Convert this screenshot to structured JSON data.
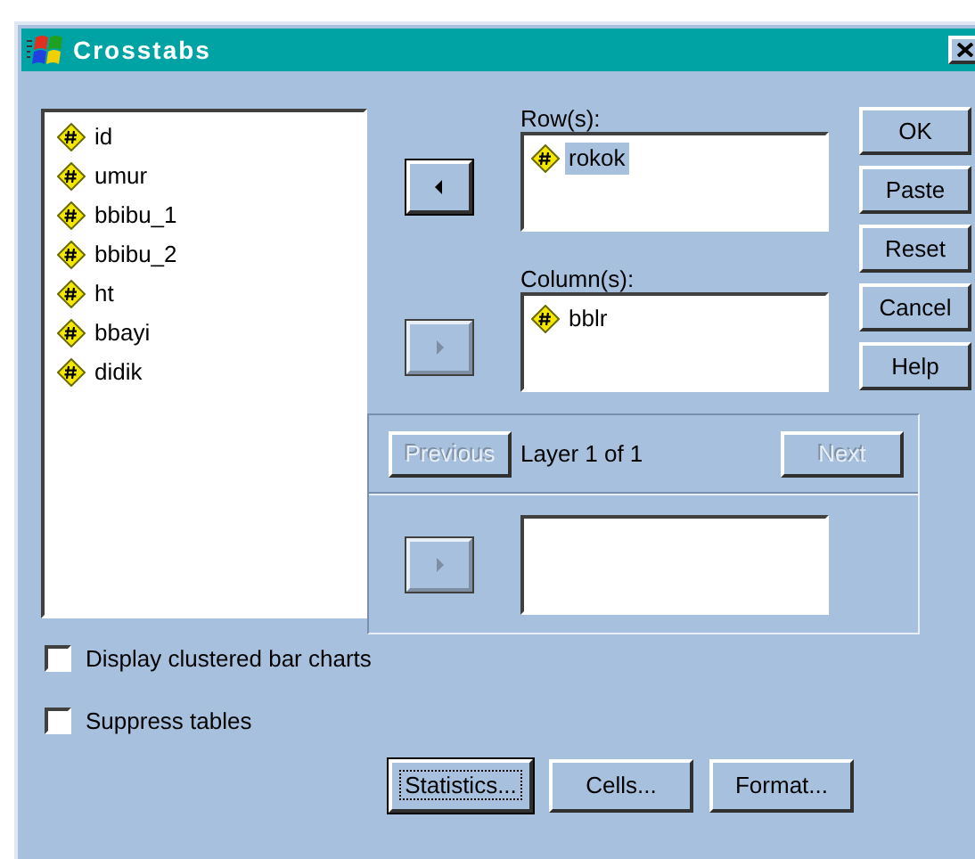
{
  "window": {
    "title": "Crosstabs"
  },
  "variables": [
    {
      "name": "id",
      "selected": false
    },
    {
      "name": "umur",
      "selected": false
    },
    {
      "name": "bbibu_1",
      "selected": false
    },
    {
      "name": "bbibu_2",
      "selected": false
    },
    {
      "name": "ht",
      "selected": false
    },
    {
      "name": "bbayi",
      "selected": false
    },
    {
      "name": "didik",
      "selected": false
    }
  ],
  "move_buttons": [
    {
      "kind": "left",
      "disabled": false
    },
    {
      "kind": "right",
      "disabled": true
    }
  ],
  "rows": {
    "label": "Row(s):",
    "items": [
      {
        "name": "rokok",
        "selected": true
      }
    ]
  },
  "columns": {
    "label": "Column(s):",
    "items": [
      {
        "name": "bblr",
        "selected": false
      }
    ]
  },
  "side_buttons": [
    {
      "label": "OK"
    },
    {
      "label": "Paste"
    },
    {
      "label": "Reset"
    },
    {
      "label": "Cancel"
    },
    {
      "label": "Help"
    }
  ],
  "layer": {
    "previous": {
      "label": "Previous",
      "disabled": true
    },
    "text": "Layer 1 of 1",
    "next": {
      "label": "Next",
      "disabled": true
    },
    "move_button": {
      "kind": "right",
      "disabled": true
    }
  },
  "options": [
    {
      "label": "Display clustered bar charts",
      "checked": false
    },
    {
      "label": "Suppress tables",
      "checked": false
    }
  ],
  "bottom_buttons": [
    {
      "label": "Statistics...",
      "focused": true
    },
    {
      "label": "Cells...",
      "focused": false
    },
    {
      "label": "Format...",
      "focused": false
    }
  ]
}
